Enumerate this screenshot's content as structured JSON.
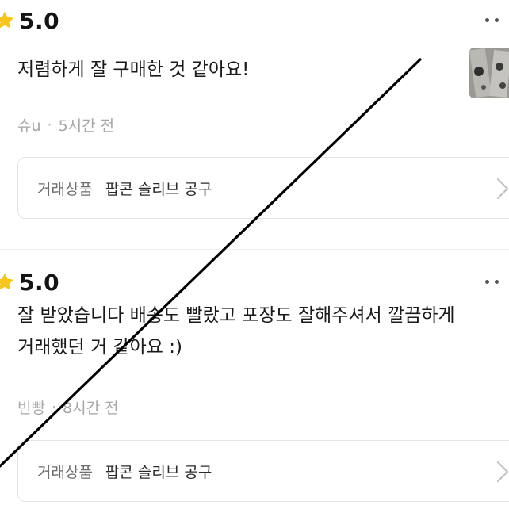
{
  "reviews": [
    {
      "rating": "5.0",
      "text_lines": [
        "저렴하게 잘 구매한 것 같아요!"
      ],
      "author": "슈u",
      "time": "5시간 전",
      "has_photo": true,
      "product_label": "거래상품",
      "product_name": "팝콘 슬리브 공구"
    },
    {
      "rating": "5.0",
      "text_lines": [
        "잘 받았습니다 배송도 빨랐고 포장도 잘해주셔서 깔끔하게",
        "거래했던 거 같아요 :)"
      ],
      "author": "빈빵",
      "time": "8시간 전",
      "has_photo": false,
      "product_label": "거래상품",
      "product_name": "팝콘 슬리브 공구"
    }
  ],
  "meta_separator": "·",
  "icons": {
    "rating": "star-icon",
    "more": "more-dots-icon",
    "chevron": "chevron-right-icon"
  },
  "colors": {
    "star": "#f7c51e",
    "meta_text": "#a6a6a6",
    "card_border": "#e4e4e4",
    "overlay_line": "#000000"
  }
}
